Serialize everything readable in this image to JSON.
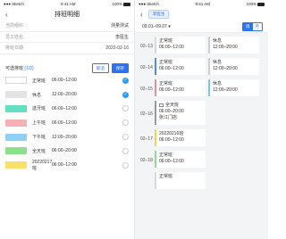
{
  "left": {
    "status": {
      "carrier": "Sketch",
      "time": "9:41 AM",
      "battery": "100%"
    },
    "nav": {
      "title": "排班明细"
    },
    "info": [
      {
        "key": "当前组织",
        "value": "测量测试"
      },
      {
        "key": "员工姓名",
        "value": "李医生"
      },
      {
        "key": "排班日期",
        "value": "2022-02-16"
      }
    ],
    "selectable": {
      "title": "可选排班",
      "count": "(1/2)",
      "cancel": "取消",
      "save": "保存"
    },
    "shifts": [
      {
        "name": "正常班",
        "time": "06:00–12:00",
        "color": "#ffffff",
        "border": "#d8d8d8",
        "checked": true
      },
      {
        "name": "休息",
        "time": "12:00–20:00",
        "color": "#e3e3e3",
        "border": "#e3e3e3",
        "checked": true
      },
      {
        "name": "送牙班",
        "time": "06:00–12:00",
        "color": "#62e0c0",
        "border": "#62e0c0",
        "checked": false
      },
      {
        "name": "上午班",
        "time": "06:00–12:00",
        "color": "#f7b0b4",
        "border": "#f7b0b4",
        "checked": false
      },
      {
        "name": "下午班",
        "time": "12:00–20:00",
        "color": "#8fd0f7",
        "border": "#8fd0f7",
        "checked": false
      },
      {
        "name": "全天班",
        "time": "06:00–20:00",
        "color": "#8de08a",
        "border": "#8de08a",
        "checked": false
      },
      {
        "name": "20220217班",
        "time": "06:00–12:00",
        "color": "#f9e06a",
        "border": "#f9e06a",
        "checked": false
      }
    ]
  },
  "right": {
    "status": {
      "carrier": "Sketch",
      "time": "9:41 AM",
      "battery": "100%"
    },
    "employee": "李医生",
    "range": "09.01–09.07",
    "toggle": {
      "week": "周",
      "month": "月"
    },
    "days": [
      {
        "date": "02–13",
        "cards": [
          {
            "t1": "正常班",
            "t2": "06:00–12:00",
            "bar": "#d8d8d8"
          },
          {
            "t1": "休息",
            "t2": "12:00–20:00",
            "bar": "#cfcfcf"
          }
        ]
      },
      {
        "date": "02–14",
        "cards": [
          {
            "t1": "正常班",
            "t2": "06:00–12:00",
            "bar": "#4a8df5"
          },
          {
            "t1": "休息",
            "t2": "12:00–20:00",
            "bar": "#cfcfcf"
          }
        ]
      },
      {
        "date": "02–15",
        "cards": [
          {
            "t1": "正常班",
            "t2": "06:00–12:00",
            "bar": "#f28b93"
          },
          {
            "t1": "休息",
            "t2": "12:00–20:00",
            "bar": "#7cc4f5"
          }
        ]
      },
      {
        "date": "02–16",
        "cards": [
          {
            "t1": "全天班",
            "t2": "06:00–20:00",
            "t3": "张江门店",
            "bar": "#9a9a9a",
            "icon": true
          }
        ]
      },
      {
        "date": "02–17",
        "cards": [
          {
            "t1": "20220216班",
            "t2": "06:00–12:00",
            "bar": "#f5d34a"
          }
        ]
      },
      {
        "date": "02–18",
        "cards": [
          {
            "t1": "正常班",
            "t2": "06:00–12:00",
            "bar": "#8de08a"
          }
        ]
      },
      {
        "date": "",
        "cards": [
          {
            "t1": "正常班",
            "t2": "",
            "bar": "#d8d8d8"
          }
        ]
      }
    ]
  }
}
